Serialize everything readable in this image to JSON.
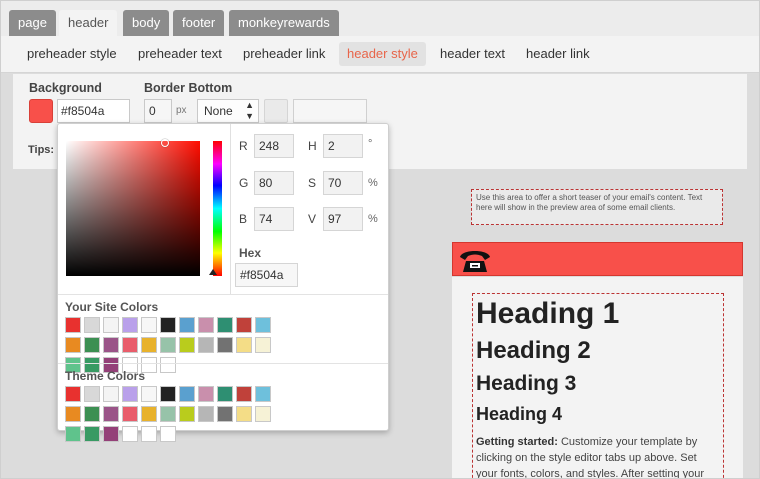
{
  "top_tabs": [
    {
      "label": "page",
      "active": false
    },
    {
      "label": "header",
      "active": true
    },
    {
      "label": "body",
      "active": false
    },
    {
      "label": "footer",
      "active": false
    },
    {
      "label": "monkeyrewards",
      "active": false
    }
  ],
  "sub_tabs": [
    {
      "label": "preheader style",
      "active": false
    },
    {
      "label": "preheader text",
      "active": false
    },
    {
      "label": "preheader link",
      "active": false
    },
    {
      "label": "header style",
      "active": true
    },
    {
      "label": "header text",
      "active": false
    },
    {
      "label": "header link",
      "active": false
    }
  ],
  "editor": {
    "background_label": "Background",
    "background_hex": "#f8504a",
    "border_bottom_label": "Border Bottom",
    "border_width": "0",
    "border_unit": "px",
    "border_style": "None",
    "tips_label": "Tips: S"
  },
  "picker": {
    "r_label": "R",
    "r_value": "248",
    "g_label": "G",
    "g_value": "80",
    "b_label": "B",
    "b_value": "74",
    "h_label": "H",
    "h_value": "2",
    "h_unit": "°",
    "s_label": "S",
    "s_value": "70",
    "s_unit": "%",
    "v_label": "V",
    "v_value": "97",
    "v_unit": "%",
    "hex_label": "Hex",
    "hex_value": "#f8504a",
    "site_colors_title": "Your Site Colors",
    "theme_colors_title": "Theme Colors",
    "site_colors": [
      "#e8312f",
      "#d8d8d8",
      "#f4f4f4",
      "#b9a0ea",
      "#f7f7f7",
      "#222222",
      "#5aa0cf",
      "#c98fac",
      "#2e8f72",
      "#c0413a",
      "#6ec0dc",
      "#e88a21",
      "#3c8f52",
      "#9a5488",
      "#e95d6b",
      "#e8b22c",
      "#97c3a9",
      "#b9cc1d",
      "#b6b6b6",
      "#727272",
      "#f4dd87",
      "#f6f2d6",
      "#5fc38c",
      "#389a63",
      "#944078",
      "#ffffff",
      "#ffffff",
      "#ffffff"
    ],
    "theme_colors": [
      "#e8312f",
      "#d8d8d8",
      "#f4f4f4",
      "#b9a0ea",
      "#f7f7f7",
      "#222222",
      "#5aa0cf",
      "#c98fac",
      "#2e8f72",
      "#c0413a",
      "#6ec0dc",
      "#e88a21",
      "#3c8f52",
      "#9a5488",
      "#e95d6b",
      "#e8b22c",
      "#97c3a9",
      "#b9cc1d",
      "#b6b6b6",
      "#727272",
      "#f4dd87",
      "#f6f2d6",
      "#5fc38c",
      "#389a63",
      "#944078",
      "#ffffff",
      "#ffffff",
      "#ffffff"
    ]
  },
  "preview": {
    "teaser_text": "Use this area to offer a short teaser of your email's content. Text here will show in the preview area of some email clients.",
    "logo_icon": "phone-icon",
    "heading1": "Heading 1",
    "heading2": "Heading 2",
    "heading3": "Heading 3",
    "heading4": "Heading 4",
    "getting_started_label": "Getting started:",
    "getting_started_text": " Customize your template by clicking on the style editor tabs up above. Set your fonts, colors, and styles. After setting your styling"
  }
}
